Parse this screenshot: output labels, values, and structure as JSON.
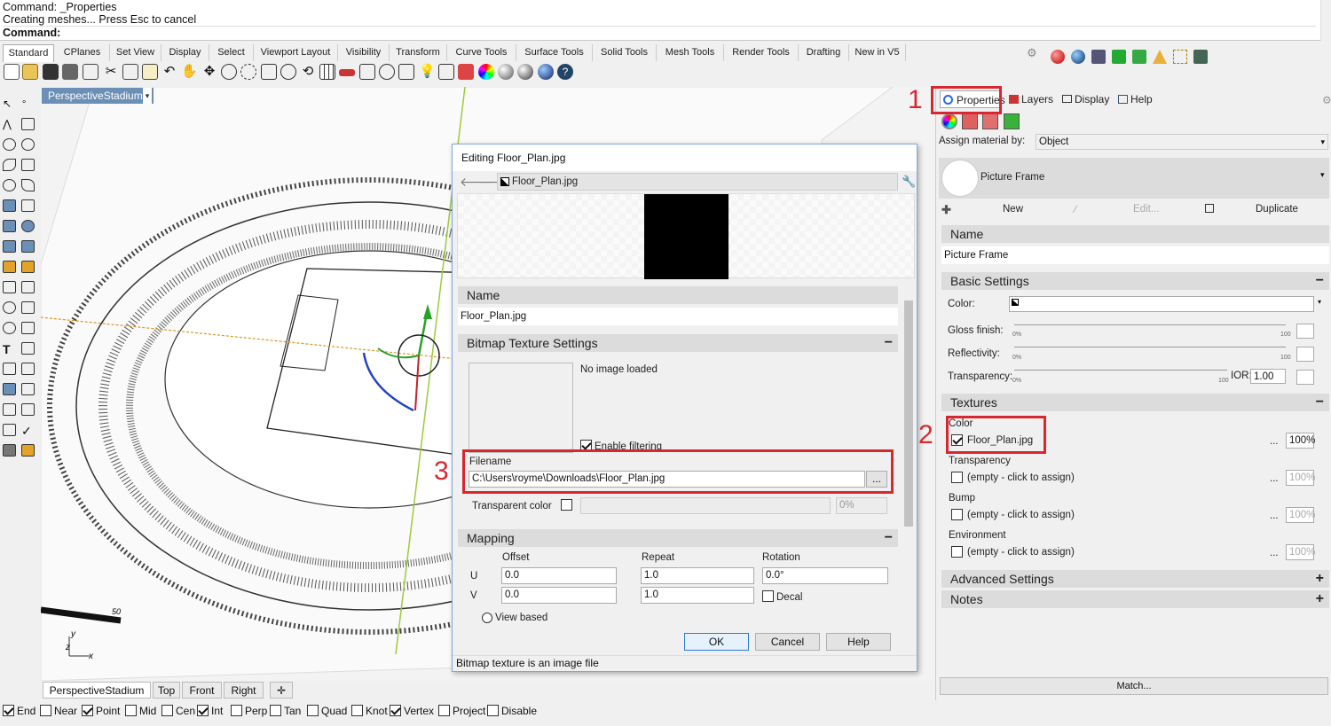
{
  "command": {
    "line1": "Command: _Properties",
    "line2": "Creating meshes... Press Esc to cancel",
    "line3": "Command:"
  },
  "tabs": [
    "Standard",
    "CPlanes",
    "Set View",
    "Display",
    "Select",
    "Viewport Layout",
    "Visibility",
    "Transform",
    "Curve Tools",
    "Surface Tools",
    "Solid Tools",
    "Mesh Tools",
    "Render Tools",
    "Drafting",
    "New in V5"
  ],
  "viewport": {
    "title": "PerspectiveStadium",
    "scale_label": "50",
    "axis_y": "y",
    "axis_z": "z",
    "axis_x": "x"
  },
  "view_tabs": [
    "PerspectiveStadium",
    "Top",
    "Front",
    "Right"
  ],
  "snaps": [
    {
      "label": "End",
      "on": true
    },
    {
      "label": "Near",
      "on": false
    },
    {
      "label": "Point",
      "on": true
    },
    {
      "label": "Mid",
      "on": false
    },
    {
      "label": "Cen",
      "on": false
    },
    {
      "label": "Int",
      "on": true
    },
    {
      "label": "Perp",
      "on": false
    },
    {
      "label": "Tan",
      "on": false
    },
    {
      "label": "Quad",
      "on": false
    },
    {
      "label": "Knot",
      "on": false
    },
    {
      "label": "Vertex",
      "on": true
    },
    {
      "label": "Project",
      "on": false
    },
    {
      "label": "Disable",
      "on": false
    }
  ],
  "panel": {
    "tabs": [
      "Properties",
      "Layers",
      "Display",
      "Help"
    ],
    "assign_label": "Assign material by:",
    "assign_value": "Object",
    "material_name": "Picture Frame",
    "new_label": "New",
    "edit_label": "Edit...",
    "duplicate_label": "Duplicate",
    "name_section": "Name",
    "name_value": "Picture Frame",
    "basic_section": "Basic Settings",
    "color_label": "Color:",
    "gloss_label": "Gloss finish:",
    "reflect_label": "Reflectivity:",
    "transp_label": "Transparency:",
    "pct0": "0%",
    "pct100": "100",
    "ior_label": "IOR:",
    "ior_value": "1.00",
    "textures_section": "Textures",
    "tex_color_label": "Color",
    "tex_color_file": "Floor_Plan.jpg",
    "tex_color_pct": "100%",
    "tex_transp_label": "Transparency",
    "tex_bump_label": "Bump",
    "tex_env_label": "Environment",
    "empty_text": "(empty - click to assign)",
    "empty_pct": "100%",
    "dots": "...",
    "advanced_section": "Advanced Settings",
    "notes_section": "Notes",
    "match_label": "Match..."
  },
  "dialog": {
    "title": "Editing Floor_Plan.jpg",
    "breadcrumb": "Floor_Plan.jpg",
    "name_section": "Name",
    "name_value": "Floor_Plan.jpg",
    "bitmap_section": "Bitmap Texture Settings",
    "no_image": "No image loaded",
    "enable_filtering": "Enable filtering",
    "filename_label": "Filename",
    "filename_value": "C:\\Users\\royme\\Downloads\\Floor_Plan.jpg",
    "browse": "...",
    "transparent_color": "Transparent color",
    "transparent_pct": "0%",
    "mapping_section": "Mapping",
    "offset_label": "Offset",
    "repeat_label": "Repeat",
    "rotation_label": "Rotation",
    "u_label": "U",
    "v_label": "V",
    "u_offset": "0.0",
    "v_offset": "0.0",
    "u_repeat": "1.0",
    "v_repeat": "1.0",
    "rotation_value": "0.0°",
    "decal_label": "Decal",
    "view_based": "View based",
    "ok": "OK",
    "cancel": "Cancel",
    "help": "Help",
    "status": "Bitmap texture is an image file"
  },
  "markers": [
    "1",
    "2",
    "3"
  ]
}
